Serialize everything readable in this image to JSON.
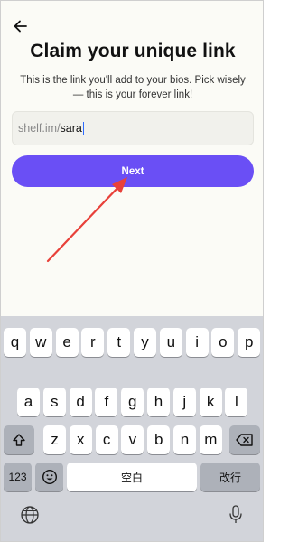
{
  "header": {
    "back_icon": "arrow-left-icon"
  },
  "title": "Claim your unique link",
  "subtitle": "This is the link you'll add to your bios. Pick wisely — this is your forever link!",
  "link_input": {
    "prefix": "shelf.im/",
    "value": "sara"
  },
  "next_button": {
    "label": "Next"
  },
  "annotation": {
    "color": "#e8413a"
  },
  "colors": {
    "accent": "#6a4ff5",
    "background": "#fbfbf6"
  },
  "keyboard": {
    "row1": [
      "q",
      "w",
      "e",
      "r",
      "t",
      "y",
      "u",
      "i",
      "o",
      "p"
    ],
    "row2": [
      "a",
      "s",
      "d",
      "f",
      "g",
      "h",
      "j",
      "k",
      "l"
    ],
    "row3": [
      "z",
      "x",
      "c",
      "v",
      "b",
      "n",
      "m"
    ],
    "numbers_label": "123",
    "space_label": "空白",
    "return_label": "改行",
    "icons": {
      "shift": "shift-icon",
      "delete": "backspace-icon",
      "emoji": "emoji-icon",
      "globe": "globe-icon",
      "mic": "microphone-icon"
    }
  }
}
